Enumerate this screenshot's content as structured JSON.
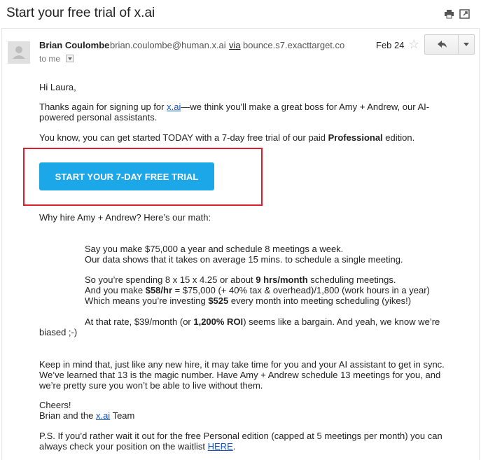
{
  "subject": "Start your free trial of x.ai",
  "toolbar_icons": [
    "print-icon",
    "popout-icon"
  ],
  "sender": {
    "name": "Brian Coulombe",
    "email": "brian.coulombe@human.x.ai",
    "via_label": "via",
    "via_domain": "bounce.s7.exacttarget.com",
    "to_label": "to me",
    "date": "Feb 24"
  },
  "actions": {
    "reply_icon": "reply-icon",
    "more_icon": "chevron-down-icon",
    "star_icon": "star-icon"
  },
  "body": {
    "greeting": "Hi Laura,",
    "p1_before": "Thanks again for signing up for ",
    "p1_link": "x.ai",
    "p1_after": "—we think you'll make a great boss for Amy + Andrew, our AI-",
    "p1_line2": "powered personal assistants.",
    "p2_before": "You know, you can get started TODAY with a 7-day free trial of our paid ",
    "p2_bold": "Professional",
    "p2_after": " edition.",
    "cta_label": "START YOUR 7-DAY FREE TRIAL",
    "math_intro": "Why hire Amy + Andrew? Here’s our math:",
    "m1": "Say you make $75,000 a year and schedule 8 meetings a week.",
    "m2": "Our data shows that it takes on average 15 mins. to schedule a single meeting.",
    "m3_before": "So you’re spending 8 x 15 x 4.25 or about ",
    "m3_bold": "9 hrs/month",
    "m3_after": " scheduling meetings.",
    "m4_before": "And you make ",
    "m4_bold": "$58/hr",
    "m4_after": " = $75,000 (+ 40% tax & overhead)/1,800 (work hours in a year)",
    "m5_before": "Which means you’re investing ",
    "m5_bold": "$525",
    "m5_after": " every month into meeting scheduling (yikes!)",
    "m6_before": "At that rate, $39/month (or ",
    "m6_bold": "1,200% ROI",
    "m6_after": ") seems like a bargain. And yeah, we know we’re",
    "m6_line2": "biased ;-)",
    "p3_l1": "Keep in mind that, just like any new hire, it may take time for you and your AI assistant to get in sync.",
    "p3_l2": "We’ve learned that 13 is the magic number. Have Amy + Andrew schedule 13 meetings for you, and",
    "p3_l3": "we’re pretty sure you won’t be able to live without them.",
    "cheers": "Cheers!",
    "sign_before": "Brian and the ",
    "sign_link": "x.ai",
    "sign_after": " Team",
    "ps_l1": "P.S. If you’d rather wait it out for the free Personal edition (capped at 5 meetings per month) you can",
    "ps_l2_before": "always check your position on the waitlist ",
    "ps_link": "HERE",
    "ps_l2_after": "."
  },
  "colors": {
    "cta": "#1ca7e8",
    "highlight_frame": "#d9202c",
    "link": "#1155cc"
  }
}
